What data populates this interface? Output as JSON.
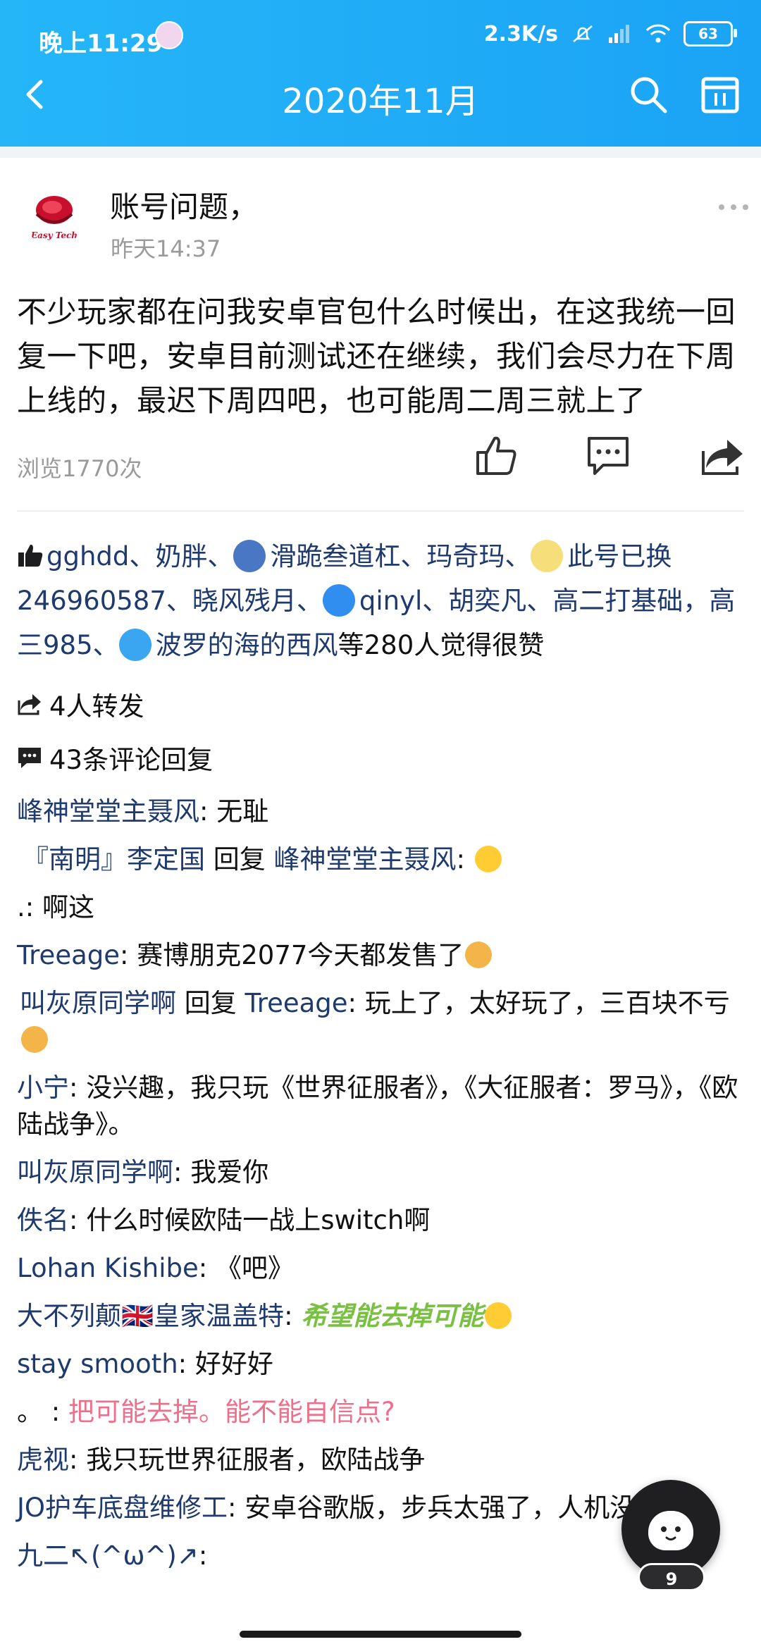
{
  "status_bar": {
    "time": "晚上11:29",
    "speed": "2.3K/s",
    "battery": "63"
  },
  "nav": {
    "title": "2020年11月"
  },
  "post": {
    "author_logo_text": "Easy Tech",
    "title": "账号问题，",
    "time": "昨天14:37",
    "body": "不少玩家都在问我安卓官包什么时候出，在这我统一回复一下吧，安卓目前测试还在继续，我们会尽力在下周上线的，最迟下周四吧，也可能周二周三就上了",
    "views": "浏览1770次"
  },
  "likes": {
    "names": [
      "gghdd、奶胖、",
      "滑跪叁道杠、玛奇玛、",
      "此号已换246960587、晓风残月、",
      "qinyl、胡奕凡、高二打基础，高三985、",
      "波罗的海的西风"
    ],
    "suffix": "等280人觉得很赞"
  },
  "forwards": "4人转发",
  "comment_count": "43条评论回复",
  "comments": [
    {
      "user": "峰神堂堂主聂风",
      "sep": ": ",
      "text": "无耻"
    },
    {
      "user": "『南明』李定国",
      "reply_word": " 回复 ",
      "reply_to": "峰神堂堂主聂风",
      "sep": ": ",
      "text": ""
    },
    {
      "user": ".",
      "sep": ": ",
      "text": "啊这"
    },
    {
      "user": "Treeage",
      "sep": ": ",
      "text": "赛博朋克2077今天都发售了"
    },
    {
      "user": "叫灰原同学啊",
      "reply_word": " 回复 ",
      "reply_to": "Treeage",
      "sep": ": ",
      "text": "玩上了，太好玩了，三百块不亏"
    },
    {
      "user": "小宁",
      "sep": ": ",
      "text": "没兴趣，我只玩《世界征服者》，《大征服者：罗马》，《欧陆战争》。"
    },
    {
      "user": "叫灰原同学啊",
      "sep": ": ",
      "text": "我爱你"
    },
    {
      "user": "佚名",
      "sep": ": ",
      "text": "什么时候欧陆一战上switch啊"
    },
    {
      "user": "Lohan Kishibe",
      "sep": ": ",
      "text": "《吧》"
    },
    {
      "user": "大不列颠🇬🇧皇家温盖特",
      "sep": ": ",
      "text": "希望能去掉可能"
    },
    {
      "user": "stay smooth",
      "sep": ": ",
      "text": "好好好"
    },
    {
      "user": "。",
      "sep": " : ",
      "text": "把可能去掉。能不能自信点?"
    },
    {
      "user": "虎视",
      "sep": ": ",
      "text": "我只玩世界征服者，欧陆战争"
    },
    {
      "user": "JO护车底盘维修工",
      "sep": ": ",
      "text": "安卓谷歌版，步兵太强了，人机没法玩，"
    },
    {
      "user": "九二↖(^ω^)↗",
      "sep": ":",
      "text": ""
    }
  ],
  "fab": {
    "badge": "9"
  },
  "colors": {
    "header_bg": "#1ba3f5",
    "username": "#1e3a6e",
    "green_text": "#7ac043",
    "pink_text": "#ef6f8a"
  },
  "icons": [
    "back-icon",
    "search-icon",
    "calendar-icon",
    "more-icon",
    "like-icon",
    "comment-icon",
    "share-icon"
  ]
}
